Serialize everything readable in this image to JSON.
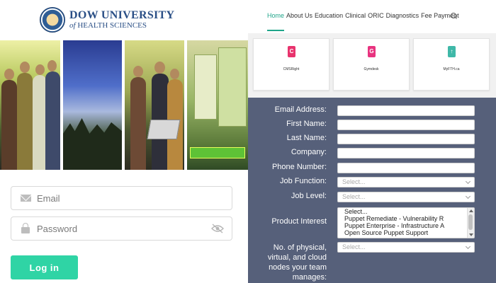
{
  "university": {
    "name_line1": "DOW UNIVERSITY",
    "name_line2_prefix": "of",
    "name_line2_rest": " HEALTH SCIENCES"
  },
  "login": {
    "email_placeholder": "Email",
    "password_placeholder": "Password",
    "login_button": "Log in"
  },
  "nav": {
    "items": [
      "Home",
      "About Us",
      "Education",
      "Clinical",
      "ORIC",
      "Diagnostics",
      "Fee Payment"
    ]
  },
  "apps": [
    {
      "name": "CMSRight",
      "color": "#e8336d",
      "glyph": "C"
    },
    {
      "name": "Gymdesk",
      "color": "#e8337f",
      "glyph": "G"
    },
    {
      "name": "MyFTH.ca",
      "color": "#3fb8a8",
      "glyph": "↑"
    }
  ],
  "form": {
    "labels": {
      "email": "Email Address:",
      "first_name": "First Name:",
      "last_name": "Last Name:",
      "company": "Company:",
      "phone": "Phone Number:",
      "job_function": "Job Function:",
      "job_level": "Job Level:",
      "product_interest": "Product Interest",
      "nodes": "No. of physical, virtual, and cloud nodes your team manages:"
    },
    "select_placeholder": "Select...",
    "product_options": [
      "Select...",
      "Puppet Remediate - Vulnerability R",
      "Puppet Enterprise - Infrastructure A",
      "Open Source Puppet Support"
    ]
  },
  "colors": {
    "accent": "#2fd4a5",
    "nav_active": "#20a58a",
    "form_background": "#56607a",
    "brand_blue": "#2a4f86"
  }
}
